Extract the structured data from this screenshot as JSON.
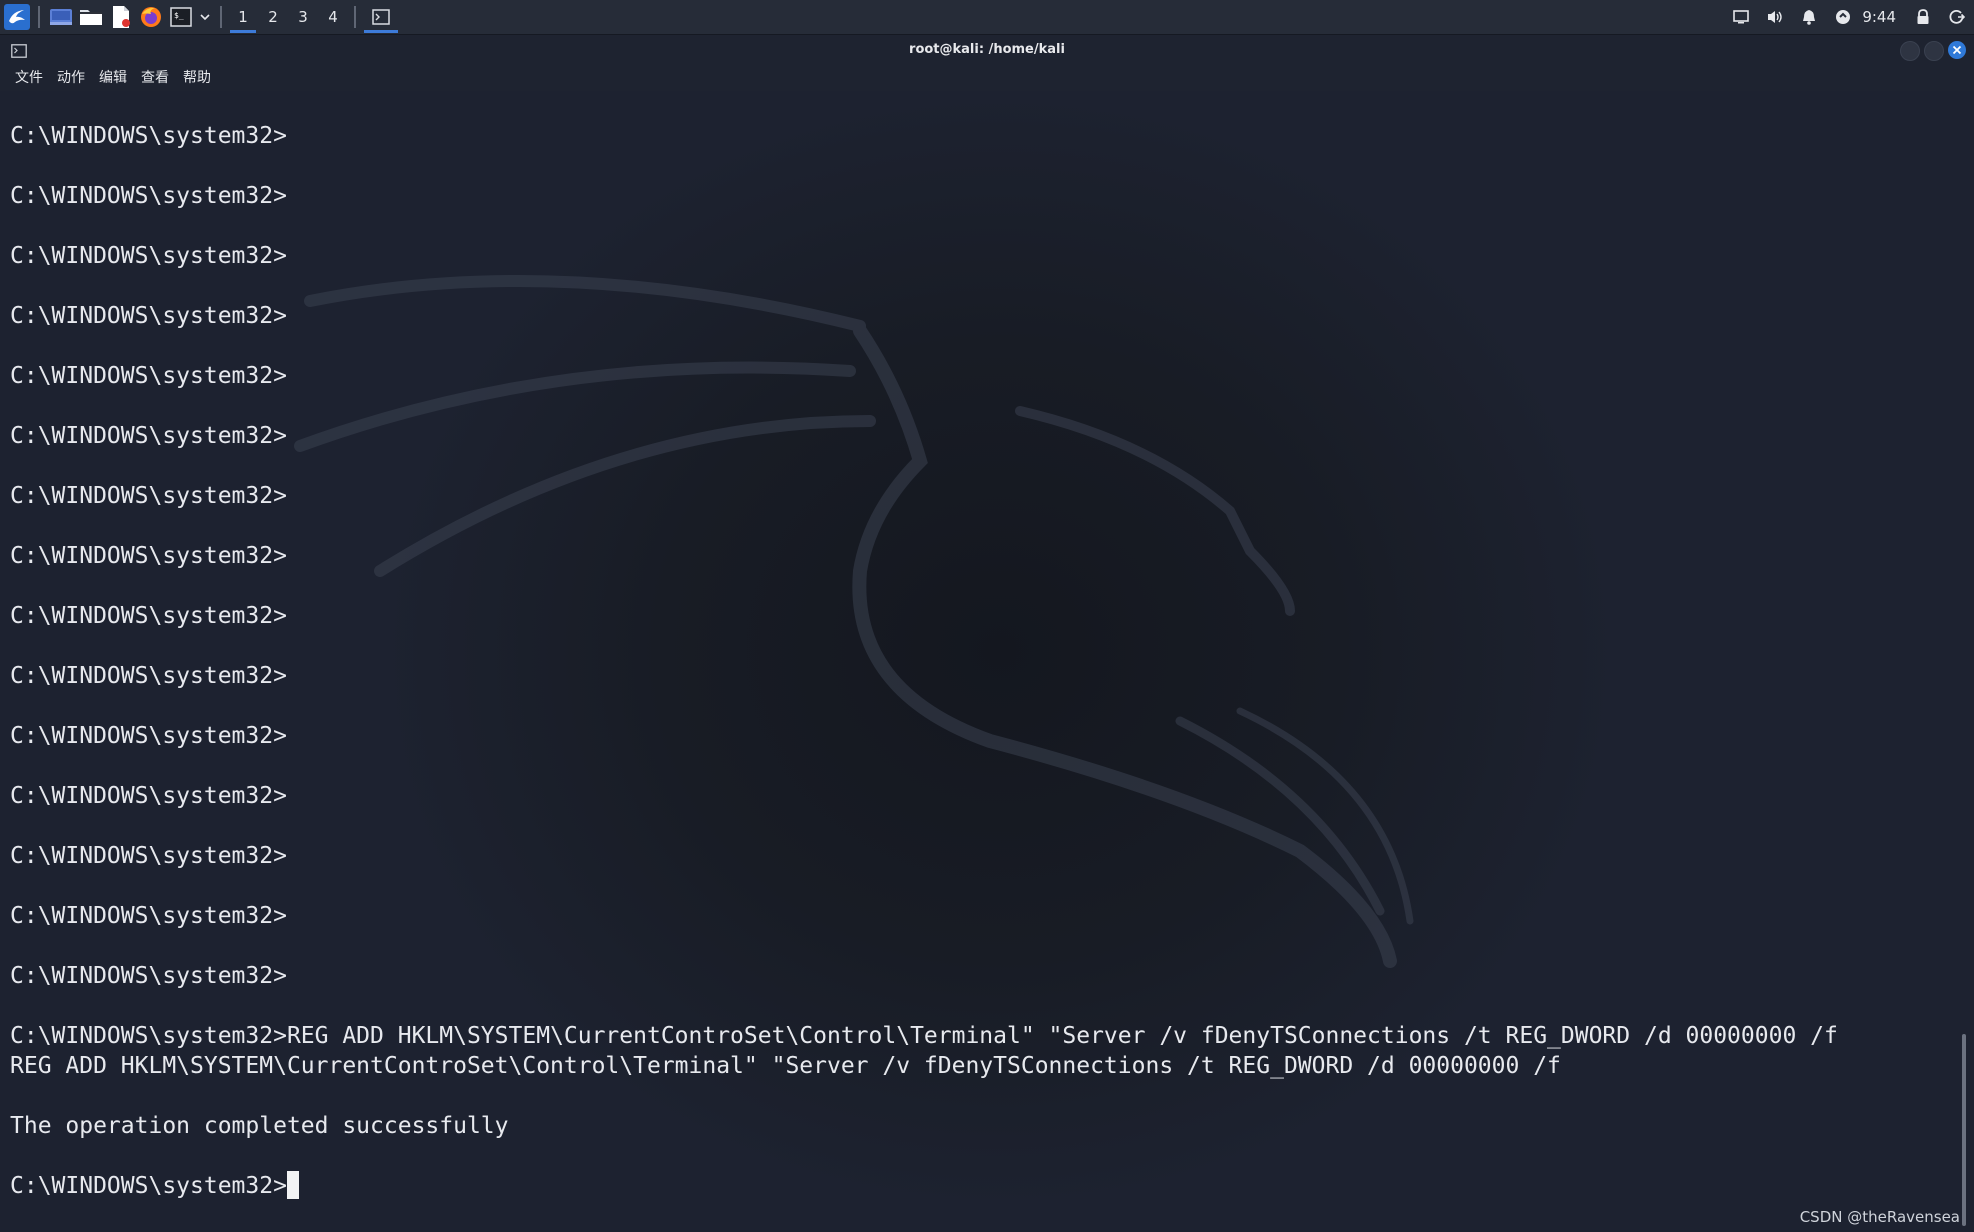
{
  "panel": {
    "workspaces": [
      "1",
      "2",
      "3",
      "4"
    ],
    "active_workspace": "1",
    "clock": "9:44"
  },
  "window": {
    "title": "root@kali: /home/kali"
  },
  "menu": {
    "items": [
      "文件",
      "动作",
      "编辑",
      "查看",
      "帮助"
    ]
  },
  "terminal": {
    "prompt_lines": [
      "C:\\WINDOWS\\system32>",
      "C:\\WINDOWS\\system32>",
      "C:\\WINDOWS\\system32>",
      "C:\\WINDOWS\\system32>",
      "C:\\WINDOWS\\system32>",
      "C:\\WINDOWS\\system32>",
      "C:\\WINDOWS\\system32>",
      "C:\\WINDOWS\\system32>",
      "C:\\WINDOWS\\system32>",
      "C:\\WINDOWS\\system32>",
      "C:\\WINDOWS\\system32>",
      "C:\\WINDOWS\\system32>",
      "C:\\WINDOWS\\system32>",
      "C:\\WINDOWS\\system32>",
      "C:\\WINDOWS\\system32>"
    ],
    "command_line": "C:\\WINDOWS\\system32>REG ADD HKLM\\SYSTEM\\CurrentControSet\\Control\\Terminal\" \"Server /v fDenyTSConnections /t REG_DWORD /d 00000000 /f",
    "echo_line": "REG ADD HKLM\\SYSTEM\\CurrentControSet\\Control\\Terminal\" \"Server /v fDenyTSConnections /t REG_DWORD /d 00000000 /f",
    "result_line": "The operation completed successfully",
    "current_prompt": "C:\\WINDOWS\\system32>"
  },
  "watermark": "CSDN @theRavensea",
  "colors": {
    "accent": "#3d7bd9",
    "terminal_bg": "#1d2230",
    "terminal_fg": "#e7e9ee"
  }
}
